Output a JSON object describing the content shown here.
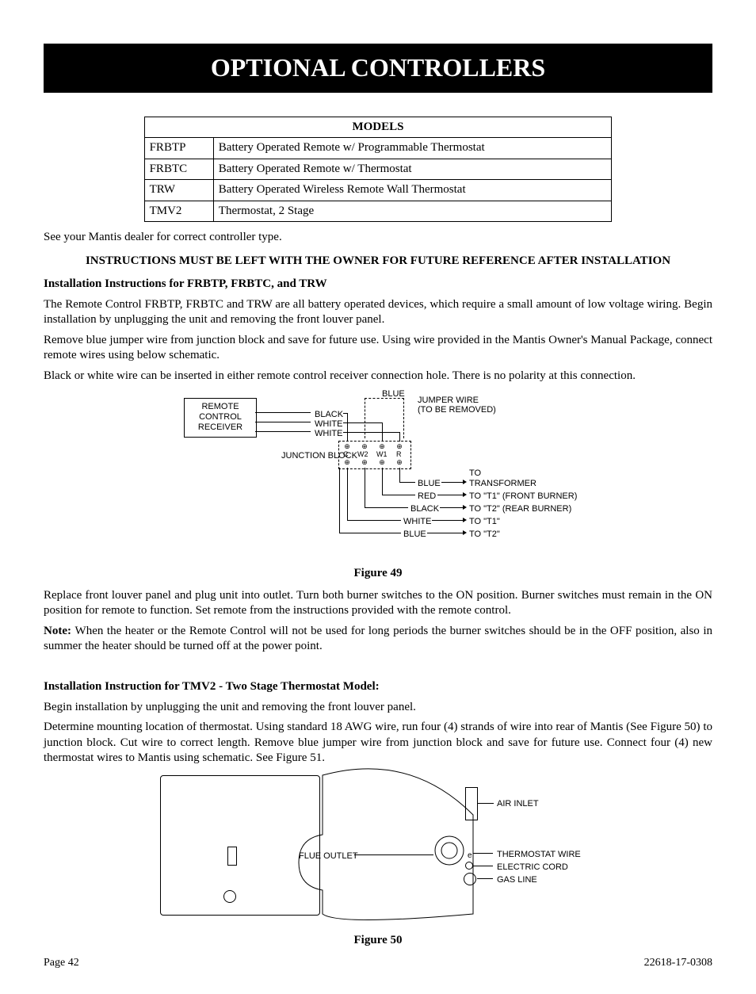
{
  "title": "OPTIONAL CONTROLLERS",
  "models": {
    "header": "MODELS",
    "rows": [
      {
        "code": "FRBTP",
        "desc": "Battery Operated Remote w/ Programmable Thermostat"
      },
      {
        "code": "FRBTC",
        "desc": "Battery Operated Remote w/ Thermostat"
      },
      {
        "code": "TRW",
        "desc": "Battery Operated Wireless Remote Wall Thermostat"
      },
      {
        "code": "TMV2",
        "desc": "Thermostat, 2 Stage"
      }
    ]
  },
  "see_dealer": "See your Mantis dealer for correct controller type.",
  "banner": "INSTRUCTIONS MUST BE LEFT WITH THE OWNER FOR FUTURE REFERENCE AFTER INSTALLATION",
  "section1": {
    "heading": "Installation Instructions for FRBTP, FRBTC, and TRW",
    "p1": "The Remote Control FRBTP, FRBTC and TRW are all battery operated devices, which require a small amount of low voltage wiring. Begin installation by unplugging the unit and removing the front louver panel.",
    "p2": "Remove blue jumper wire from junction block and save for future use.  Using wire provided in the Mantis Owner's Manual Package, connect remote wires using below schematic.",
    "p3": "Black or white wire can be inserted in either remote control receiver connection hole. There is no polarity at this connection."
  },
  "fig49": {
    "caption": "Figure 49",
    "remote_box": "REMOTE CONTROL RECEIVER",
    "junction": "JUNCTION BLOCK",
    "blue_top": "BLUE",
    "black": "BLACK",
    "white1": "WHITE",
    "white2": "WHITE",
    "jumper1": "JUMPER WIRE",
    "jumper2": "(TO BE REMOVED)",
    "c": "C",
    "w2": "W2",
    "w1": "W1",
    "r": "R",
    "out_blue": "BLUE",
    "out_red": "RED",
    "out_black": "BLACK",
    "out_white": "WHITE",
    "out_blue2": "BLUE",
    "to": "TO",
    "transformer": "TRANSFORMER",
    "t1f": "TO \"T1\" (FRONT BURNER)",
    "t2r": "TO \"T2\" (REAR BURNER)",
    "t1": "TO \"T1\"",
    "t2": "TO \"T2\""
  },
  "section1b": {
    "p4": "Replace front louver panel and plug unit into outlet.  Turn both burner switches to the ON position.  Burner switches must remain in the ON position for remote to function.  Set remote from the instructions provided with the remote control.",
    "note_label": "Note:",
    "note": "When the heater or the Remote Control will not be used for long periods the burner switches should be in the OFF position, also in summer the heater should be turned off at the power point."
  },
  "section2": {
    "heading": "Installation Instruction for TMV2 - Two Stage Thermostat Model:",
    "p1": "Begin installation by unplugging the unit and removing the front louver panel.",
    "p2": "Determine mounting location of thermostat.  Using standard 18 AWG wire, run four (4) strands of wire into rear of Mantis (See Figure 50) to junction block.  Cut wire to correct length.  Remove blue jumper wire from junction block and save for future use. Connect four (4) new thermostat wires to Mantis using schematic. See Figure 51."
  },
  "fig50": {
    "caption": "Figure 50",
    "flue": "FLUE OUTLET",
    "air": "AIR INLET",
    "therm": "THERMOSTAT WIRE",
    "elec": "ELECTRIC CORD",
    "gas": "GAS LINE"
  },
  "footer": {
    "left": "Page 42",
    "right": "22618-17-0308"
  }
}
